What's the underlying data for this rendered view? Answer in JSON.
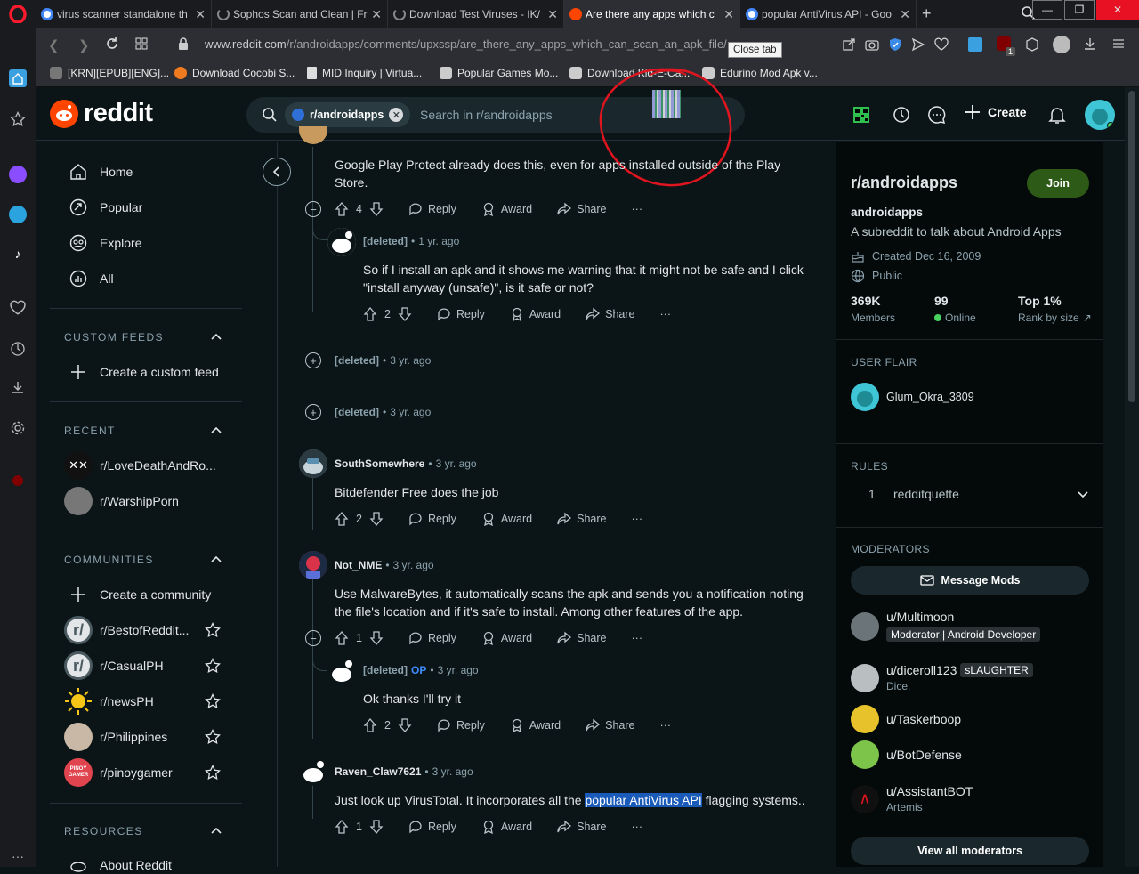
{
  "browser": {
    "tabs": [
      {
        "title": "virus scanner standalone th",
        "icon": "google-icon",
        "color": "#4285f4"
      },
      {
        "title": "Sophos Scan and Clean | Fr",
        "icon": "loading-icon",
        "color": "#888888"
      },
      {
        "title": "Download Test Viruses - IK/",
        "icon": "loading-icon",
        "color": "#888888"
      },
      {
        "title": "Are there any apps which c",
        "icon": "reddit-icon",
        "color": "#ff4500",
        "active": true
      },
      {
        "title": "popular AntiVirus API - Goo",
        "icon": "google-icon",
        "color": "#4285f4"
      }
    ],
    "new_tab": "+",
    "url_host": "www.reddit.com",
    "url_path": "/r/androidapps/comments/upxssp/are_there_any_apps_which_can_scan_an_apk_file/",
    "tooltip": "Close tab",
    "bookmarks": [
      {
        "label": "[KRN][EPUB][ENG]...",
        "color": "#777777"
      },
      {
        "label": "Download Cocobi S...",
        "color": "#f07a1f"
      },
      {
        "label": "MID Inquiry | Virtua...",
        "color": "#dddddd"
      },
      {
        "label": "Popular Games Mo...",
        "color": "#cccccc"
      },
      {
        "label": "Download Kid-E-Ca...",
        "color": "#cccccc"
      },
      {
        "label": "Edurino Mod Apk v...",
        "color": "#cccccc"
      }
    ],
    "extension_badge": "1"
  },
  "reddit": {
    "logo": "reddit",
    "search_chip": "r/androidapps",
    "search_placeholder": "Search in r/androidapps",
    "create_label": "Create",
    "nav": [
      {
        "label": "Home",
        "icon": "home-icon"
      },
      {
        "label": "Popular",
        "icon": "popular-icon"
      },
      {
        "label": "Explore",
        "icon": "explore-icon"
      },
      {
        "label": "All",
        "icon": "all-icon"
      }
    ],
    "custom_feeds_header": "CUSTOM FEEDS",
    "create_custom_feed": "Create a custom feed",
    "recent_header": "RECENT",
    "recent": [
      {
        "label": "r/LoveDeathAndRo...",
        "color": "#111111"
      },
      {
        "label": "r/WarshipPorn",
        "color": "#666666"
      }
    ],
    "communities_header": "COMMUNITIES",
    "create_community": "Create a community",
    "communities": [
      {
        "label": "r/BestofReddit...",
        "avatar": "r/",
        "color": "#4a5a60"
      },
      {
        "label": "r/CasualPH",
        "avatar": "r/",
        "color": "#4a5a60"
      },
      {
        "label": "r/newsPH",
        "avatar": "",
        "color": "#f5c518"
      },
      {
        "label": "r/Philippines",
        "avatar": "",
        "color": "#c9b8a6"
      },
      {
        "label": "r/pinoygamer",
        "avatar": "PINOY GAMER",
        "color": "#e0454f"
      }
    ],
    "resources_header": "RESOURCES",
    "about_reddit": "About Reddit"
  },
  "comments": [
    {
      "id": "c1",
      "text": "Google Play Protect already does this, even for apps installed outside of the Play Store.",
      "votes": "4"
    },
    {
      "id": "c2",
      "author": "[deleted]",
      "time": "1 yr. ago",
      "text": "So if I install an apk and it shows me warning that it might not be safe and I click \"install anyway (unsafe)\", is it safe or not?",
      "votes": "2"
    },
    {
      "id": "c3",
      "author": "[deleted]",
      "time": "3 yr. ago"
    },
    {
      "id": "c4",
      "author": "[deleted]",
      "time": "3 yr. ago"
    },
    {
      "id": "c5",
      "author": "SouthSomewhere",
      "time": "3 yr. ago",
      "text": "Bitdefender Free does the job",
      "votes": "2"
    },
    {
      "id": "c6",
      "author": "Not_NME",
      "time": "3 yr. ago",
      "text": "Use MalwareBytes, it automatically scans the apk and sends you a notification noting the file's location and if it's safe to install. Among other features of the app.",
      "votes": "1"
    },
    {
      "id": "c7",
      "author": "[deleted]",
      "op": "OP",
      "time": "3 yr. ago",
      "text": "Ok thanks I'll try it",
      "votes": "2"
    },
    {
      "id": "c8",
      "author": "Raven_Claw7621",
      "time": "3 yr. ago",
      "text_before": "Just look up VirusTotal. It incorporates all the ",
      "text_highlight": "popular AntiVirus API",
      "text_after": " flagging systems..",
      "votes": "1"
    }
  ],
  "action_labels": {
    "reply": "Reply",
    "award": "Award",
    "share": "Share",
    "more": "···"
  },
  "dot": "•",
  "sidebar": {
    "title": "r/androidapps",
    "join": "Join",
    "name": "androidapps",
    "description": "A subreddit to talk about Android Apps",
    "created": "Created Dec 16, 2009",
    "visibility": "Public",
    "stats": [
      {
        "value": "369K",
        "label": "Members"
      },
      {
        "value": "99",
        "label": "Online"
      },
      {
        "value": "Top 1%",
        "label": "Rank by size"
      }
    ],
    "user_flair_header": "USER FLAIR",
    "user_flair_name": "Glum_Okra_3809",
    "rules_header": "RULES",
    "rules": [
      {
        "num": "1",
        "label": "redditquette"
      }
    ],
    "moderators_header": "MODERATORS",
    "message_mods": "Message Mods",
    "moderators": [
      {
        "name": "u/Multimoon",
        "flair": "Moderator | Android Developer",
        "sub": "",
        "color": "#6b7478"
      },
      {
        "name": "u/diceroll123",
        "flair": "sLAUGHTER",
        "sub": "Dice.",
        "color": "#b9bec0"
      },
      {
        "name": "u/Taskerboop",
        "flair": "",
        "sub": "",
        "color": "#e7c22a"
      },
      {
        "name": "u/BotDefense",
        "flair": "",
        "sub": "",
        "color": "#7cc44a"
      },
      {
        "name": "u/AssistantBOT",
        "flair": "",
        "sub": "Artemis",
        "color": "#101010"
      }
    ],
    "view_all_mods": "View all moderators"
  }
}
